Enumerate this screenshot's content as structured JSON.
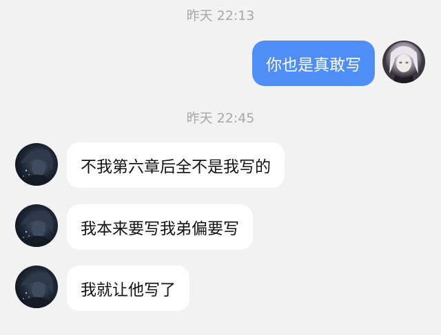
{
  "timestamps": {
    "first": "昨天 22:13",
    "second": "昨天 22:45"
  },
  "messages": {
    "outgoing": [
      {
        "text": "你也是真敢写",
        "avatar": "anime-girl-avatar"
      }
    ],
    "incoming": [
      {
        "text": "不我第六章后全不是我写的",
        "avatar": "dark-character-avatar"
      },
      {
        "text": "我本来要写我弟偏要写",
        "avatar": "dark-character-avatar"
      },
      {
        "text": "我就让他写了",
        "avatar": "dark-character-avatar"
      }
    ]
  },
  "colors": {
    "background": "#f2f2f2",
    "outgoing_bubble": "#4f8ef6",
    "incoming_bubble": "#ffffff",
    "timestamp_text": "#a7a7a7"
  }
}
